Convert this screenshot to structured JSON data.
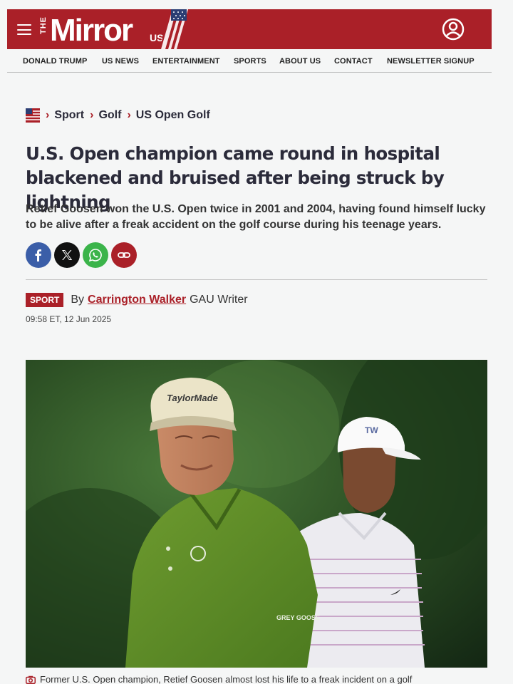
{
  "header": {
    "logo_the": "THE",
    "logo_name": "Mirror",
    "logo_edition": "US"
  },
  "nav": {
    "items": [
      {
        "label": "DONALD TRUMP"
      },
      {
        "label": "US NEWS"
      },
      {
        "label": "ENTERTAINMENT"
      },
      {
        "label": "SPORTS"
      },
      {
        "label": "ABOUT US"
      },
      {
        "label": "CONTACT"
      },
      {
        "label": "NEWSLETTER SIGNUP"
      }
    ]
  },
  "breadcrumb": {
    "items": [
      {
        "label": "Sport"
      },
      {
        "label": "Golf"
      },
      {
        "label": "US Open Golf"
      }
    ]
  },
  "article": {
    "headline": "U.S. Open champion came round in hospital blackened and bruised after being struck by lightning",
    "standfirst": "Retief Goosen won the U.S. Open twice in 2001 and 2004, having found himself lucky to be alive after a freak accident on the golf course during his teenage years.",
    "tag": "SPORT",
    "by": "By",
    "author": "Carrington Walker",
    "role": "GAU Writer",
    "timestamp": "09:58 ET, 12 Jun 2025",
    "caption": "Former U.S. Open champion, Retief Goosen almost lost his life to a freak incident on a golf"
  },
  "share": {
    "icons": [
      "facebook-icon",
      "x-icon",
      "whatsapp-icon",
      "link-icon"
    ]
  },
  "hero_image": {
    "cap_text_left": "TaylorMade",
    "shirt_text": "GREY GOOSE"
  },
  "colors": {
    "brand_red": "#aa2028",
    "facebook": "#3b5ea8",
    "whatsapp": "#3bb44a"
  }
}
